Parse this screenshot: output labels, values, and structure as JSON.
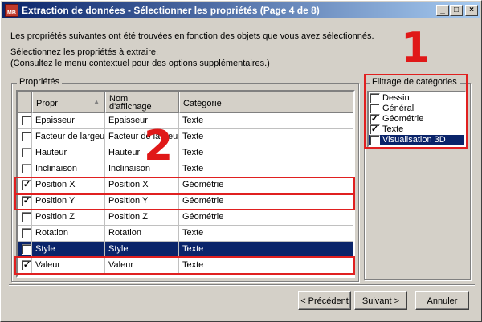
{
  "window": {
    "title": "Extraction de données - Sélectionner les propriétés (Page 4 de 8)",
    "icon_text": "AutoCAD",
    "minimize": "_",
    "maximize": "□",
    "close": "×"
  },
  "intro": {
    "line1": "Les propriétés suivantes ont été trouvées en fonction des objets que vous avez sélectionnés.",
    "line2": "Sélectionnez les propriétés à extraire.",
    "line3": "(Consultez le menu contextuel pour des options supplémentaires.)"
  },
  "properties": {
    "group_label": "Propriétés",
    "columns": {
      "prop": "Propr",
      "display_line1": "Nom",
      "display_line2": "d'affichage",
      "category": "Catégorie"
    },
    "sort_indicator": "▲",
    "rows": [
      {
        "checked": false,
        "prop": "Epaisseur",
        "display": "Epaisseur",
        "category": "Texte",
        "selected": false
      },
      {
        "checked": false,
        "prop": "Facteur de largeur",
        "display": "Facteur de largeur",
        "category": "Texte",
        "selected": false
      },
      {
        "checked": false,
        "prop": "Hauteur",
        "display": "Hauteur",
        "category": "Texte",
        "selected": false
      },
      {
        "checked": false,
        "prop": "Inclinaison",
        "display": "Inclinaison",
        "category": "Texte",
        "selected": false
      },
      {
        "checked": true,
        "prop": "Position X",
        "display": "Position X",
        "category": "Géométrie",
        "selected": false
      },
      {
        "checked": true,
        "prop": "Position Y",
        "display": "Position Y",
        "category": "Géométrie",
        "selected": false
      },
      {
        "checked": false,
        "prop": "Position Z",
        "display": "Position Z",
        "category": "Géométrie",
        "selected": false
      },
      {
        "checked": false,
        "prop": "Rotation",
        "display": "Rotation",
        "category": "Texte",
        "selected": false
      },
      {
        "checked": false,
        "prop": "Style",
        "display": "Style",
        "category": "Texte",
        "selected": true
      },
      {
        "checked": true,
        "prop": "Valeur",
        "display": "Valeur",
        "category": "Texte",
        "selected": false
      }
    ]
  },
  "filter": {
    "group_label": "Filtrage de catégories",
    "items": [
      {
        "checked": false,
        "label": "Dessin",
        "selected": false
      },
      {
        "checked": false,
        "label": "Général",
        "selected": false
      },
      {
        "checked": true,
        "label": "Géométrie",
        "selected": false
      },
      {
        "checked": true,
        "label": "Texte",
        "selected": false
      },
      {
        "checked": false,
        "label": "Visualisation 3D",
        "selected": true
      }
    ]
  },
  "annotations": {
    "one": "1",
    "two": "2"
  },
  "checkmark": "✓",
  "buttons": {
    "back": "< Précédent",
    "next": "Suivant >",
    "cancel": "Annuler"
  },
  "colors": {
    "selection": "#0a246a",
    "annotation_red": "#e02020",
    "face": "#d4d0c8"
  }
}
